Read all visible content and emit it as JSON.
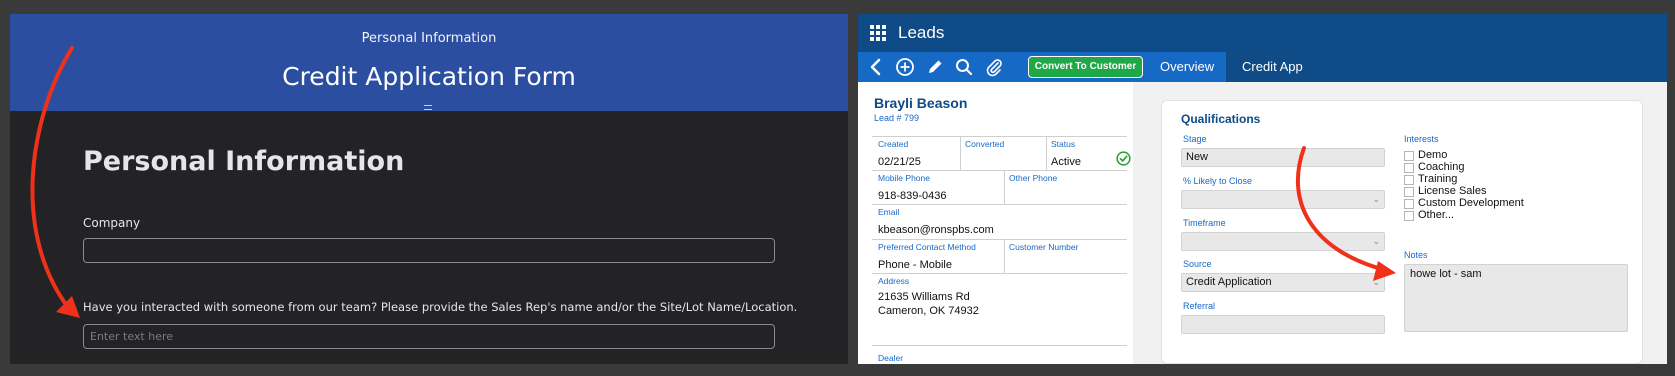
{
  "left_form": {
    "header_subtitle": "Personal Information",
    "header_title": "Credit Application Form",
    "section_title": "Personal Information",
    "company_label": "Company",
    "company_value": "",
    "rep_question": "Have you interacted with someone from our team? Please provide the Sales Rep's name and/or the Site/Lot Name/Location.",
    "rep_placeholder": "Enter text here"
  },
  "crm": {
    "app_title": "Leads",
    "toolbar": {
      "convert_label": "Convert To Customer"
    },
    "tabs": [
      {
        "label": "Overview"
      },
      {
        "label": "Credit App"
      }
    ],
    "lead": {
      "name": "Brayli  Beason",
      "number": "Lead # 799",
      "created_label": "Created",
      "created_value": "02/21/25",
      "converted_label": "Converted",
      "converted_value": "",
      "status_label": "Status",
      "status_value": "Active",
      "mobile_label": "Mobile Phone",
      "mobile_value": "918-839-0436",
      "other_phone_label": "Other Phone",
      "other_phone_value": "",
      "email_label": "Email",
      "email_value": "kbeason@ronspbs.com",
      "contact_method_label": "Preferred Contact Method",
      "contact_method_value": "Phone - Mobile",
      "customer_number_label": "Customer Number",
      "customer_number_value": "",
      "address_label": "Address",
      "address_line1": "21635 Williams Rd",
      "address_line2": "Cameron, OK 74932",
      "dealer_label": "Dealer"
    },
    "qualifications": {
      "title": "Qualifications",
      "stage_label": "Stage",
      "stage_value": "New",
      "likely_label": "% Likely to Close",
      "likely_value": "",
      "timeframe_label": "Timeframe",
      "timeframe_value": "",
      "source_label": "Source",
      "source_value": "Credit Application",
      "referral_label": "Referral",
      "referral_value": "",
      "interests_label": "Interests",
      "interests": [
        {
          "label": "Demo",
          "checked": false
        },
        {
          "label": "Coaching",
          "checked": false
        },
        {
          "label": "Training",
          "checked": false
        },
        {
          "label": "License Sales",
          "checked": false
        },
        {
          "label": "Custom Development",
          "checked": false
        },
        {
          "label": "Other...",
          "checked": false
        }
      ],
      "notes_label": "Notes",
      "notes_value": "howe lot - sam"
    },
    "colors": {
      "topbar": "#0f4b86",
      "toolbar": "#1769c6",
      "convert_button": "#1fa846",
      "label_blue": "#1769c6",
      "annotation_arrow": "#f0311a"
    }
  }
}
